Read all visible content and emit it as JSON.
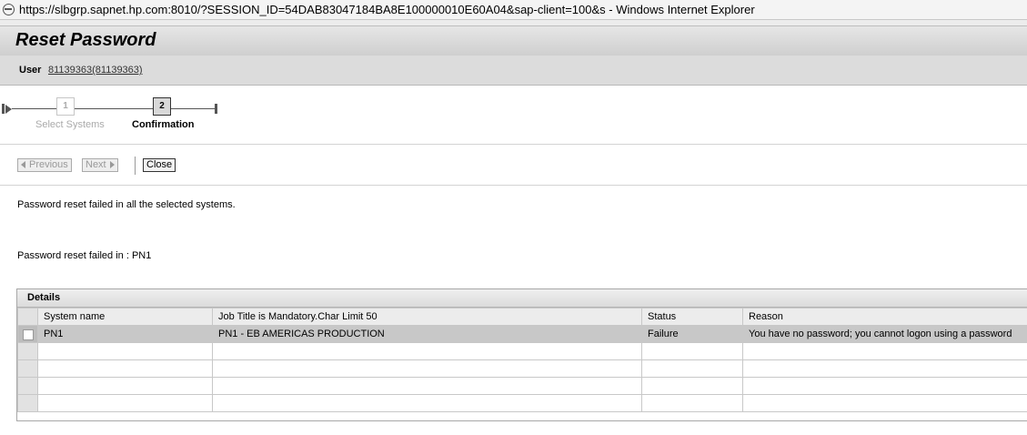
{
  "window": {
    "title": "https://slbgrp.sapnet.hp.com:8010/?SESSION_ID=54DAB83047184BA8E100000010E60A04&sap-client=100&s - Windows Internet Explorer"
  },
  "header": {
    "title": "Reset Password",
    "user_label": "User",
    "user_value": "81139363(81139363)"
  },
  "roadmap": {
    "steps": [
      {
        "number": "1",
        "label": "Select Systems",
        "state": "inactive"
      },
      {
        "number": "2",
        "label": "Confirmation",
        "state": "current"
      }
    ]
  },
  "toolbar": {
    "previous_label": "Previous",
    "next_label": "Next",
    "close_label": "Close"
  },
  "messages": {
    "all_failed": "Password reset failed in all the selected systems.",
    "failed_in": "Password reset failed in : PN1"
  },
  "details": {
    "caption": "Details",
    "columns": [
      "System name",
      "Job Title is Mandatory.Char Limit 50",
      "Status",
      "Reason"
    ],
    "rows": [
      [
        "PN1",
        "PN1 - EB AMERICAS PRODUCTION",
        "Failure",
        "You have no password; you cannot logon using a password"
      ]
    ],
    "empty_rows": 4
  }
}
